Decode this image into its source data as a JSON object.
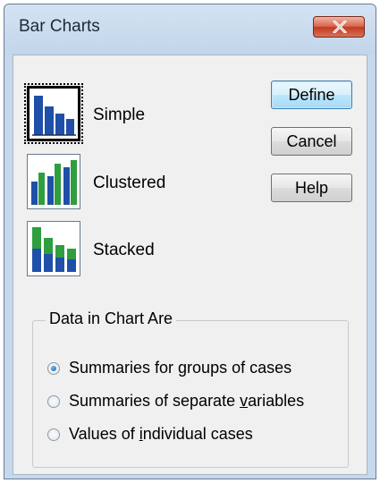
{
  "window": {
    "title": "Bar Charts",
    "close_icon": "close-icon"
  },
  "chart_types": [
    {
      "label": "Simple",
      "icon": "simple-bar-chart-icon",
      "selected": true
    },
    {
      "label": "Clustered",
      "icon": "clustered-bar-chart-icon",
      "selected": false
    },
    {
      "label": "Stacked",
      "icon": "stacked-bar-chart-icon",
      "selected": false
    }
  ],
  "buttons": {
    "define": "Define",
    "cancel": "Cancel",
    "help": "Help"
  },
  "data_group": {
    "legend": "Data in Chart Are",
    "options": [
      {
        "pre": "Summaries for ",
        "mnemonic": "g",
        "post": "roups of cases",
        "checked": true
      },
      {
        "pre": "Summaries of separate ",
        "mnemonic": "v",
        "post": "ariables",
        "checked": false
      },
      {
        "pre": "Values of ",
        "mnemonic": "i",
        "post": "ndividual cases",
        "checked": false
      }
    ]
  },
  "colors": {
    "bar_blue": "#1f4fa8",
    "bar_green": "#2e9e3e",
    "close_red": "#c13b22"
  }
}
